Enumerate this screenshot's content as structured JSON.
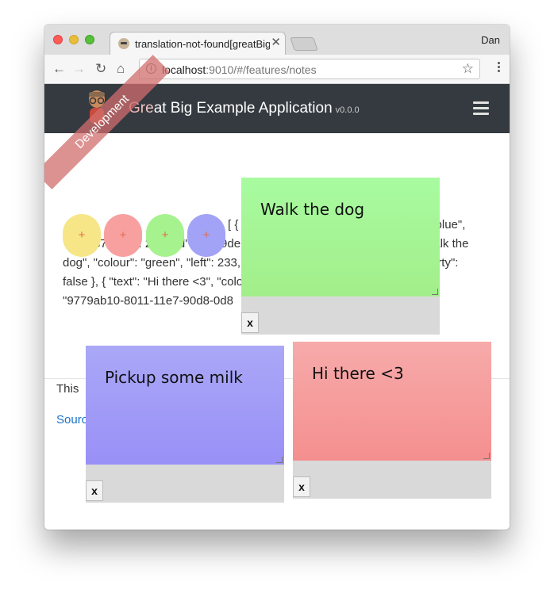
{
  "browser": {
    "tab_title": "translation-not-found[greatBig",
    "tab_close": "✕",
    "profile_name": "Dan",
    "url_host": "localhost",
    "url_rest": ":9010/#/features/notes"
  },
  "app": {
    "brand_prefix": "G",
    "brand_accent": "re",
    "brand_rest": "at Big Example Application",
    "version": "v0.0.0",
    "ribbon_label": "Development"
  },
  "buttons": [
    {
      "label": "+",
      "color": "#f7e687"
    },
    {
      "label": "+",
      "color": "#f8a0a0"
    },
    {
      "label": "+",
      "color": "#a6f28f"
    },
    {
      "label": "+",
      "color": "#a2a2f6"
    }
  ],
  "json_dump": "[ { \"text\": \"Pickup some milk\", \"colour\": \"blue\", \"left\": 37, \"top\": 248, \"id\": \"...-19de67bc5a5f\", \"dirty\": false }, { \"text\": \"Walk the dog\", \"colour\": \"green\", \"left\": 233, \"top\": 36, \"id\": \"...-19de67bc5a5f\", \"dirty\": false }, { \"text\": \"Hi there <3\", \"colour\": \"red\", \"left\": 298, \"top\": 243, \"id\": \"9779ab10-8011-11e7-90d8-0d8",
  "description": "This",
  "source_link": "Source",
  "notes": [
    {
      "text": "Walk the dog",
      "close": "x",
      "color_top": "#a8fba0",
      "color_bottom": "#a2ee8a"
    },
    {
      "text": "Pickup some milk",
      "close": "x",
      "color_top": "#aaa8f7",
      "color_bottom": "#9990f7"
    },
    {
      "text": "Hi there <3",
      "close": "x",
      "color_top": "#f7aaaa",
      "color_bottom": "#f58f8f"
    }
  ]
}
